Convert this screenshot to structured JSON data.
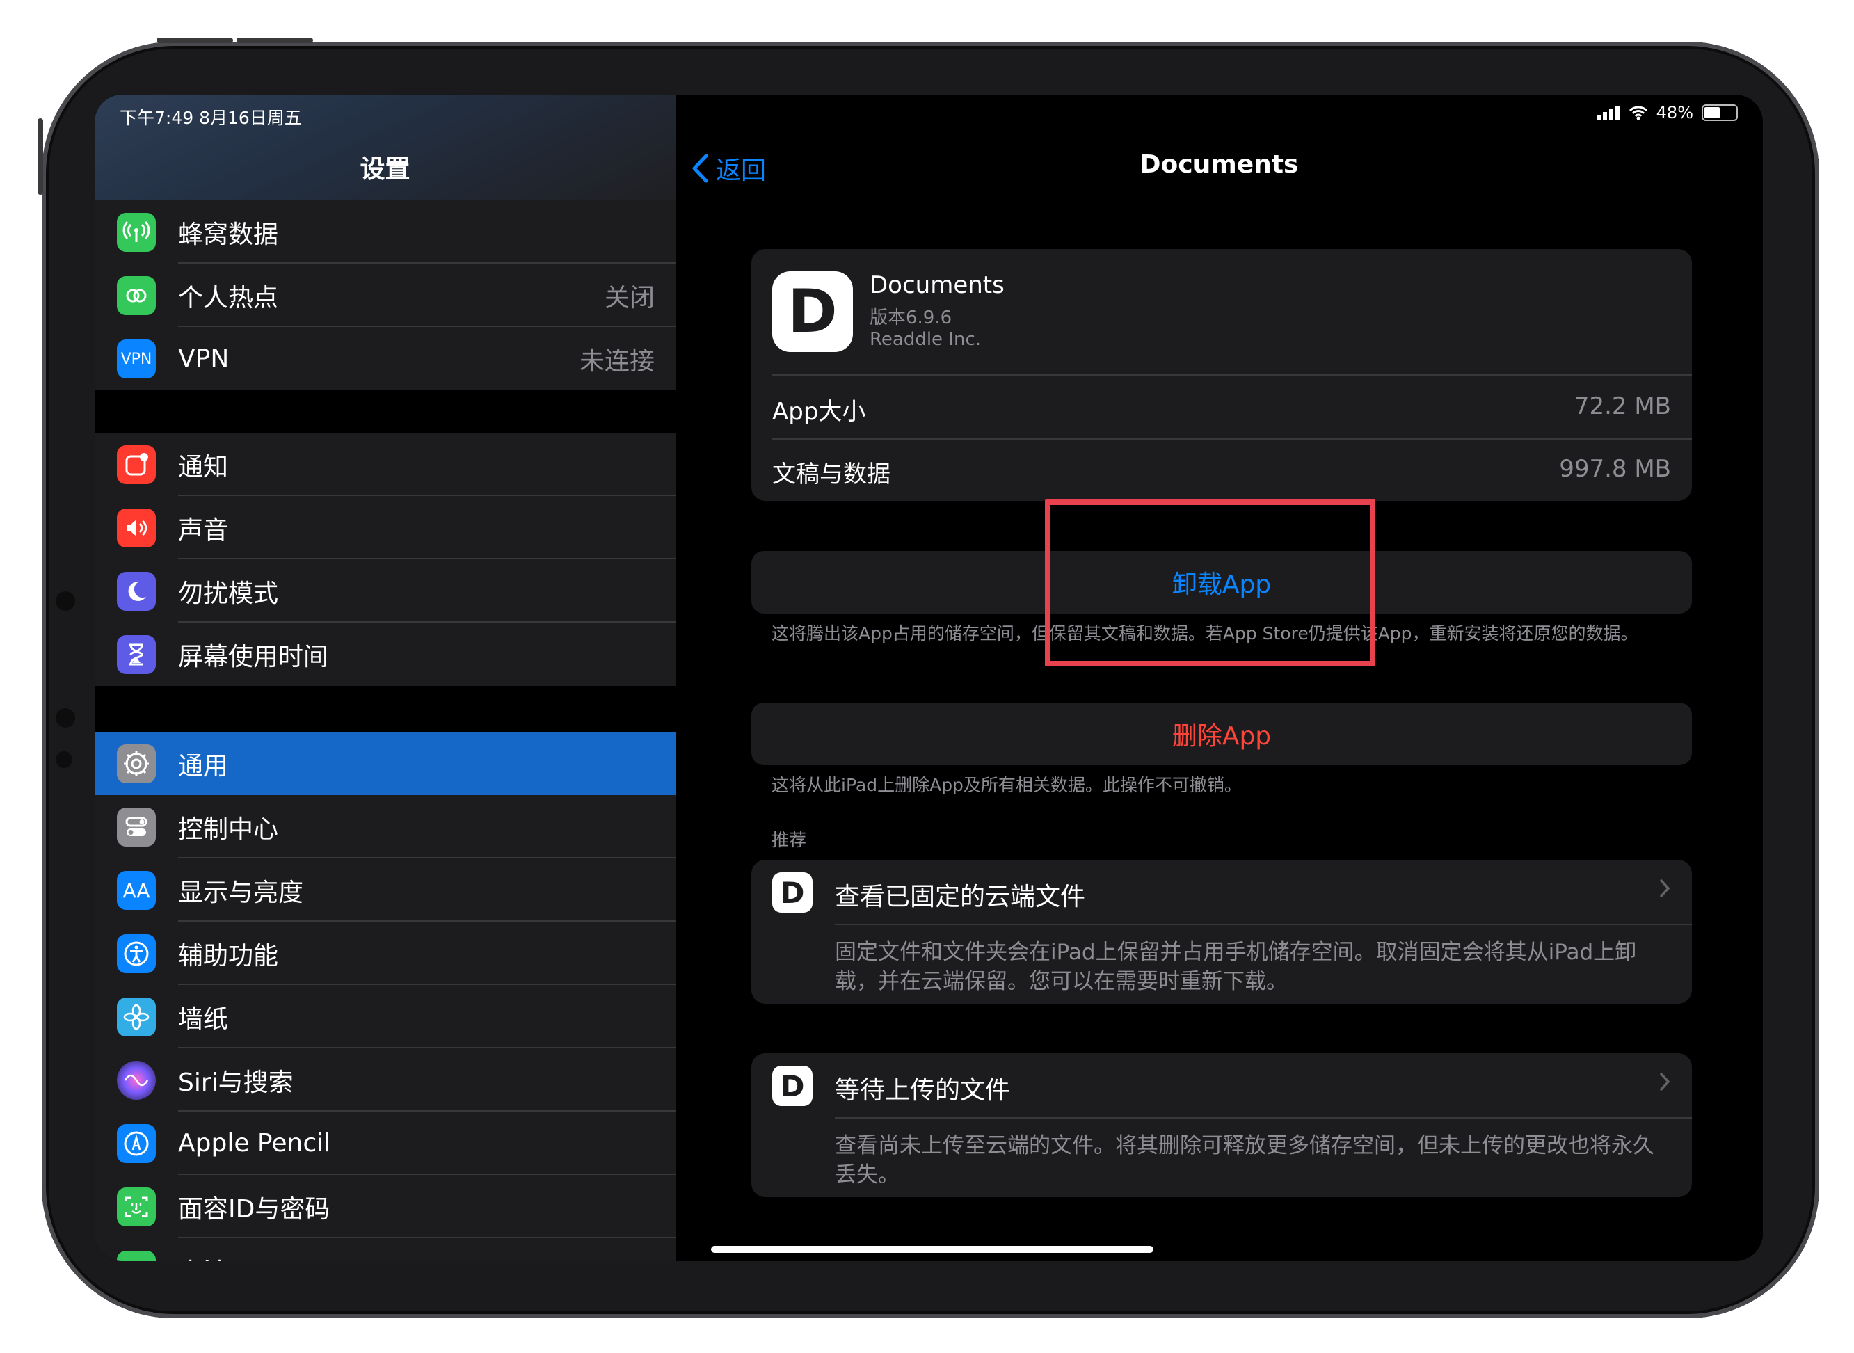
{
  "status": {
    "time_date": "下午7:49   8月16日周五",
    "battery": "48%"
  },
  "sidebar": {
    "title": "设置",
    "items": [
      {
        "label": "蜂窝数据",
        "value": "",
        "icon": "antenna-icon",
        "color": "#34c759"
      },
      {
        "label": "个人热点",
        "value": "关闭",
        "icon": "hotspot-icon",
        "color": "#34c759"
      },
      {
        "label": "VPN",
        "value": "未连接",
        "icon": "vpn-icon",
        "icon_text": "VPN",
        "color": "#0a84ff"
      },
      {
        "label": "通知",
        "value": "",
        "icon": "notifications-icon",
        "color": "#ff3b30"
      },
      {
        "label": "声音",
        "value": "",
        "icon": "speaker-icon",
        "color": "#ff3b30"
      },
      {
        "label": "勿扰模式",
        "value": "",
        "icon": "moon-icon",
        "color": "#5e5ce6"
      },
      {
        "label": "屏幕使用时间",
        "value": "",
        "icon": "hourglass-icon",
        "color": "#5e5ce6"
      },
      {
        "label": "通用",
        "value": "",
        "icon": "gear-icon",
        "color": "#8e8e93",
        "active": true
      },
      {
        "label": "控制中心",
        "value": "",
        "icon": "toggles-icon",
        "color": "#8e8e93"
      },
      {
        "label": "显示与亮度",
        "value": "",
        "icon": "text-size-icon",
        "icon_text": "AA",
        "color": "#0a84ff"
      },
      {
        "label": "辅助功能",
        "value": "",
        "icon": "accessibility-icon",
        "color": "#0a84ff"
      },
      {
        "label": "墙纸",
        "value": "",
        "icon": "flower-icon",
        "color": "#32ade6"
      },
      {
        "label": "Siri与搜索",
        "value": "",
        "icon": "siri-icon",
        "color": "#3a3a8c"
      },
      {
        "label": "Apple Pencil",
        "value": "",
        "icon": "pencil-icon",
        "color": "#0a84ff"
      },
      {
        "label": "面容ID与密码",
        "value": "",
        "icon": "face-id-icon",
        "color": "#34c759"
      },
      {
        "label": "电池",
        "value": "",
        "icon": "battery-icon",
        "color": "#34c759"
      }
    ]
  },
  "detail": {
    "back_label": "返回",
    "nav_title": "Documents",
    "app": {
      "name": "Documents",
      "version": "版本6.9.6",
      "developer": "Readdle Inc.",
      "icon_letter": "D"
    },
    "app_size_label": "App大小",
    "app_size_value": "72.2 MB",
    "docs_label": "文稿与数据",
    "docs_value": "997.8 MB",
    "offload_label": "卸载App",
    "offload_note": "这将腾出该App占用的储存空间，但保留其文稿和数据。若App Store仍提供该App，重新安装将还原您的数据。",
    "delete_label": "删除App",
    "delete_note": "这将从此iPad上删除App及所有相关数据。此操作不可撤销。",
    "recommend_header": "推荐",
    "recommendations": [
      {
        "title": "查看已固定的云端文件",
        "desc": "固定文件和文件夹会在iPad上保留并占用手机储存空间。取消固定会将其从iPad上卸载，并在云端保留。您可以在需要时重新下载。"
      },
      {
        "title": "等待上传的文件",
        "desc": "查看尚未上传至云端的文件。将其删除可释放更多储存空间，但未上传的更改也将永久丢失。"
      }
    ],
    "accent_color": "#0a84ff",
    "destructive_color": "#ff453a",
    "highlight_color": "#e8424f"
  }
}
